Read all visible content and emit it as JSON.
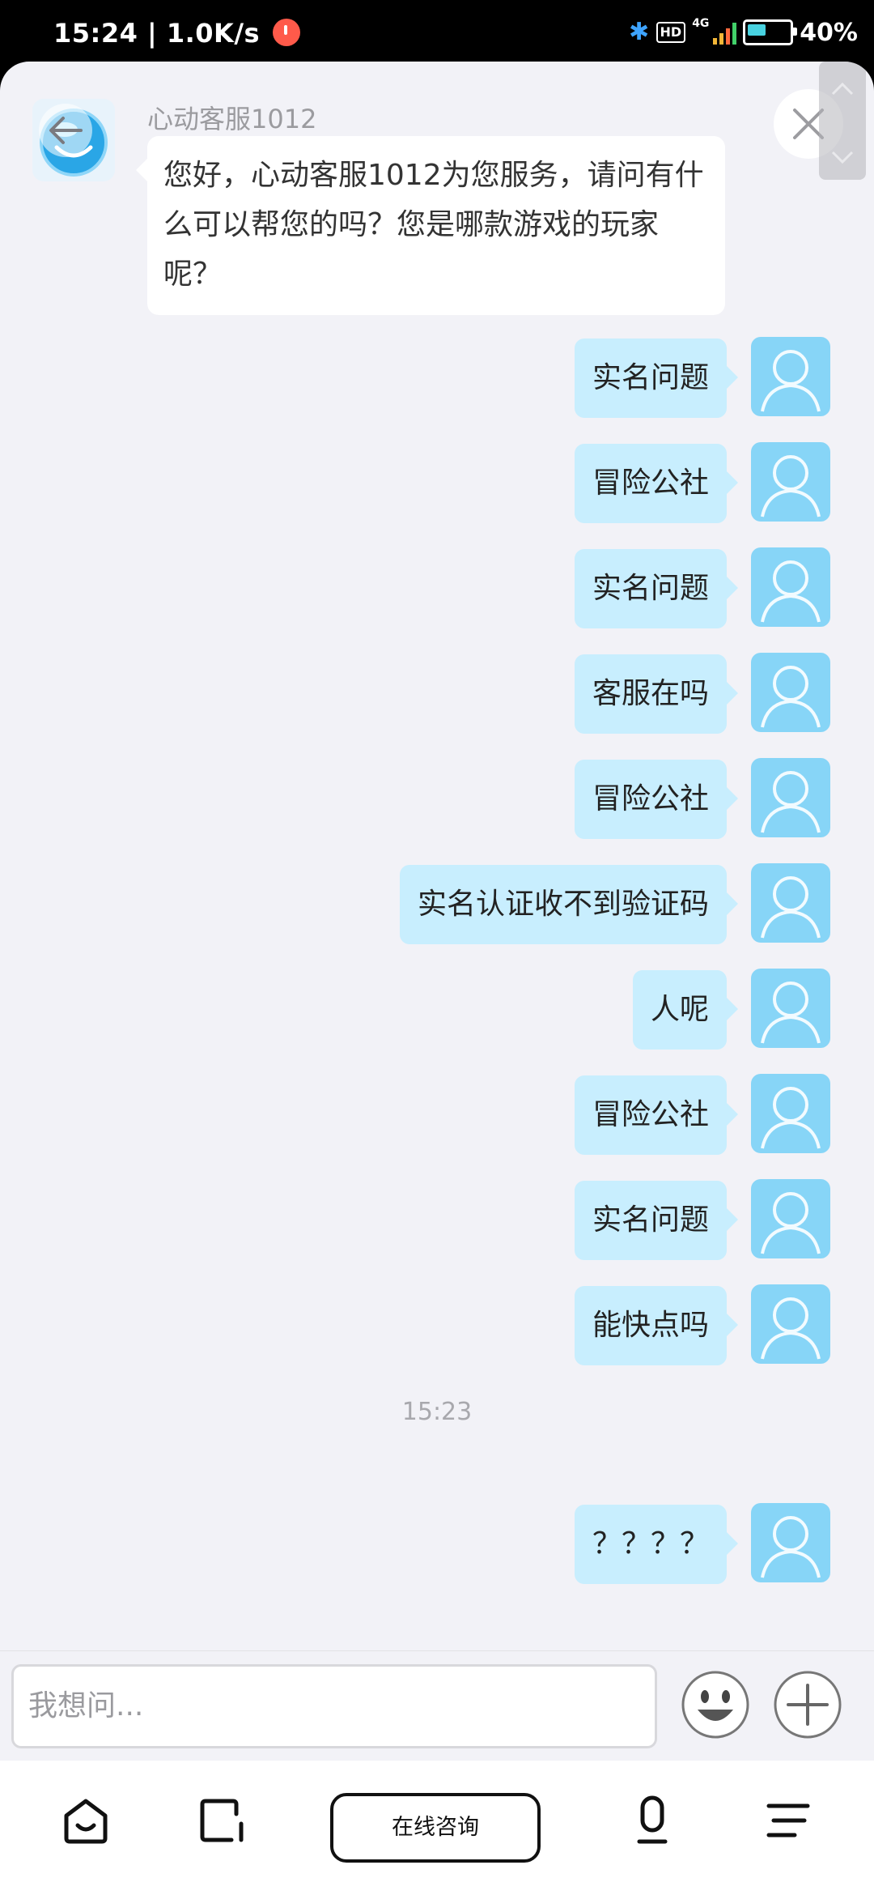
{
  "status_bar": {
    "time_speed": "15:24 | 1.0K/s",
    "hd": "HD",
    "network": "4G",
    "battery": "40%"
  },
  "agent": {
    "name": "心动客服1012",
    "greeting": "您好，心动客服1012为您服务，请问有什么可以帮您的吗？您是哪款游戏的玩家呢？"
  },
  "messages": [
    {
      "text": "实名问题"
    },
    {
      "text": "冒险公社"
    },
    {
      "text": "实名问题"
    },
    {
      "text": "客服在吗"
    },
    {
      "text": "冒险公社"
    },
    {
      "text": "实名认证收不到验证码"
    },
    {
      "text": "人呢"
    },
    {
      "text": "冒险公社"
    },
    {
      "text": "实名问题"
    },
    {
      "text": "能快点吗"
    }
  ],
  "timestamp": "15:23",
  "last_message": "？？？？",
  "input": {
    "placeholder": "我想问..."
  },
  "nav": {
    "consult_label": "在线咨询"
  },
  "colors": {
    "user_bubble": "#c8eefe",
    "user_avatar": "#87d5f7",
    "background": "#f2f2f7"
  }
}
